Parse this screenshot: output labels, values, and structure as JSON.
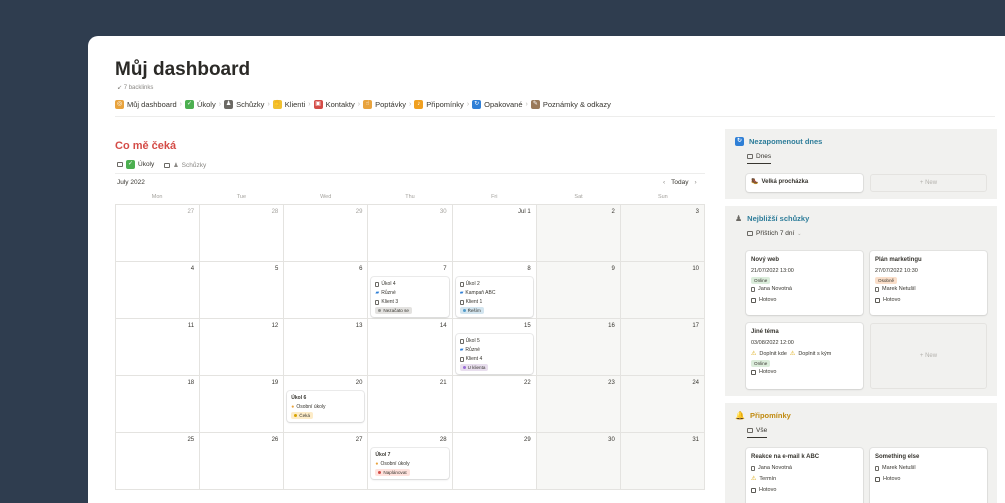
{
  "page": {
    "title": "Můj dashboard",
    "backlinks": "7 backlinks"
  },
  "nav": [
    {
      "label": "Můj dashboard",
      "icon": "target-icon",
      "color": "#e8a33d"
    },
    {
      "label": "Úkoly",
      "icon": "check-icon",
      "color": "#4caf50"
    },
    {
      "label": "Schůzky",
      "icon": "person-icon",
      "color": "#6b6964"
    },
    {
      "label": "Klienti",
      "icon": "handshake-icon",
      "color": "#f0c030"
    },
    {
      "label": "Kontakty",
      "icon": "contact-card-icon",
      "color": "#d44c47"
    },
    {
      "label": "Poptávky",
      "icon": "hand-icon",
      "color": "#e8a33d"
    },
    {
      "label": "Připomínky",
      "icon": "bell-icon",
      "color": "#f0a020"
    },
    {
      "label": "Opakované",
      "icon": "repeat-icon",
      "color": "#2f7fd6"
    },
    {
      "label": "Poznámky & odkazy",
      "icon": "memo-icon",
      "color": "#9a7a5a"
    }
  ],
  "calendar_section": {
    "title": "Co mě čeká",
    "tabs": [
      {
        "label": "Úkoly",
        "active": true
      },
      {
        "label": "Schůzky",
        "active": false
      }
    ],
    "month": "July 2022",
    "today": "Today",
    "weekdays": [
      "Mon",
      "Tue",
      "Wed",
      "Thu",
      "Fri",
      "Sat",
      "Sun"
    ],
    "days": [
      {
        "n": "27",
        "dim": true
      },
      {
        "n": "28",
        "dim": true
      },
      {
        "n": "29",
        "dim": true
      },
      {
        "n": "30",
        "dim": true
      },
      {
        "n": "Jul 1"
      },
      {
        "n": "2",
        "wk": true
      },
      {
        "n": "3",
        "wk": true
      },
      {
        "n": "4"
      },
      {
        "n": "5"
      },
      {
        "n": "6"
      },
      {
        "n": "7"
      },
      {
        "n": "8"
      },
      {
        "n": "9",
        "wk": true
      },
      {
        "n": "10",
        "wk": true
      },
      {
        "n": "11"
      },
      {
        "n": "12"
      },
      {
        "n": "13"
      },
      {
        "n": "14"
      },
      {
        "n": "15"
      },
      {
        "n": "16",
        "wk": true
      },
      {
        "n": "17",
        "wk": true
      },
      {
        "n": "18"
      },
      {
        "n": "19"
      },
      {
        "n": "20"
      },
      {
        "n": "21"
      },
      {
        "n": "22"
      },
      {
        "n": "23",
        "wk": true
      },
      {
        "n": "24",
        "wk": true
      },
      {
        "n": "25"
      },
      {
        "n": "26"
      },
      {
        "n": "27"
      },
      {
        "n": "28"
      },
      {
        "n": "29"
      },
      {
        "n": "30",
        "wk": true
      },
      {
        "n": "31",
        "wk": true
      }
    ],
    "events": [
      {
        "day": 10,
        "title": "Úkol 4",
        "cat": "Různé",
        "client": "Klient 3",
        "status": "Nezačato se",
        "status_color": "#e3e2e0",
        "dot": "#91918e"
      },
      {
        "day": 11,
        "title": "Úkol 2",
        "cat": "Kampaň ABC",
        "client": "Klient 1",
        "status": "Řeším",
        "status_color": "#d3e5ef",
        "dot": "#529cca"
      },
      {
        "day": 18,
        "title": "Úkol 5",
        "cat": "Různé",
        "client": "Klient 4",
        "status": "U klienta",
        "status_color": "#e8deee",
        "dot": "#9a6dd7"
      },
      {
        "day": 23,
        "title": "Úkol 6",
        "cat": "Osobní úkoly",
        "status": "Čeká",
        "status_color": "#fdecc8",
        "dot": "#d9a400"
      },
      {
        "day": 31,
        "title": "Úkol 7",
        "cat": "Osobní úkoly",
        "status": "Naplánovat",
        "status_color": "#ffe2dd",
        "dot": "#d44c47"
      }
    ]
  },
  "reminder_today": {
    "title": "Nezapomenout dnes",
    "view": "Dnes",
    "card": "Velká procházka",
    "new": "New"
  },
  "meetings": {
    "title": "Nejbližší schůzky",
    "view": "Příštích 7 dní",
    "cards": [
      {
        "title": "Nový web",
        "date": "21/07/2022 13:00",
        "tag": "Online",
        "tag_color": "#dbeddb",
        "person": "Jana Novotná",
        "done": "Hotovo"
      },
      {
        "title": "Plán marketingu",
        "date": "27/07/2022 10:30",
        "tag": "Osobně",
        "tag_color": "#fadec9",
        "person": "Marek Netušil",
        "done": "Hotovo"
      },
      {
        "title": "Jiné téma",
        "date": "03/08/2022 12:00",
        "warn1": "Doplnit kde",
        "warn2": "Doplnit s kým",
        "tag": "Online",
        "tag_color": "#dbeddb",
        "done": "Hotovo"
      }
    ],
    "new": "New"
  },
  "reminders": {
    "title": "Připomínky",
    "view": "Vše",
    "cards": [
      {
        "title": "Reakce na e-mail k ABC",
        "person": "Jana Novotná",
        "warn": "Termín",
        "done": "Hotovo"
      },
      {
        "title": "Something else",
        "person": "Marek Netušil",
        "done": "Hotovo"
      }
    ]
  },
  "colors": {
    "bg": "#2f3d4f",
    "accent_red": "#d44c47",
    "accent_blue": "#2e7d9a",
    "panel": "#f1f1ef"
  }
}
